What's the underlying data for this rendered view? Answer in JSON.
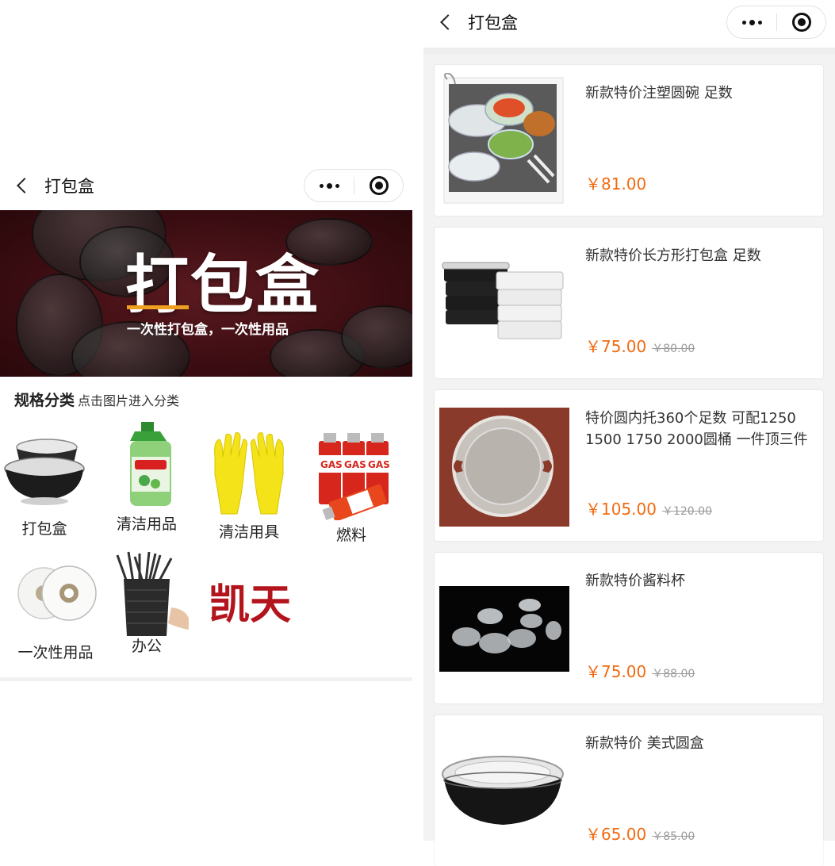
{
  "left": {
    "nav": {
      "title": "打包盒"
    },
    "banner": {
      "title": "打包盒",
      "subtitle": "一次性打包盒，一次性用品"
    },
    "category_header": {
      "title": "规格分类",
      "hint": "点击图片进入分类"
    },
    "categories": [
      {
        "label": "打包盒",
        "icon": "black-bowl-icon"
      },
      {
        "label": "清洁用品",
        "icon": "detergent-bottle-icon"
      },
      {
        "label": "清洁用具",
        "icon": "rubber-gloves-icon"
      },
      {
        "label": "燃料",
        "icon": "gas-canister-icon",
        "badge": "GAS"
      },
      {
        "label": "一次性用品",
        "icon": "paper-roll-icon"
      },
      {
        "label": "办公",
        "icon": "pen-holder-icon"
      },
      {
        "label": "",
        "icon": "kaitian-logo",
        "text": "凯天"
      }
    ]
  },
  "right": {
    "nav": {
      "title": "打包盒"
    },
    "products": [
      {
        "name": "新款特价注塑圆碗 足数",
        "price": "￥81.00",
        "original": "",
        "image": "round-bowls-with-salad"
      },
      {
        "name": "新款特价长方形打包盒 足数",
        "price": "￥75.00",
        "original": "￥80.00",
        "image": "rectangular-boxes"
      },
      {
        "name": "特价圆内托360个足数 可配1250 1500 1750 2000圆桶 一件顶三件",
        "price": "￥105.00",
        "original": "￥120.00",
        "image": "round-inner-tray"
      },
      {
        "name": "新款特价酱料杯",
        "price": "￥75.00",
        "original": "￥88.00",
        "image": "sauce-cups"
      },
      {
        "name": "新款特价 美式圆盒",
        "price": "￥65.00",
        "original": "￥85.00",
        "image": "american-round-box"
      }
    ]
  }
}
